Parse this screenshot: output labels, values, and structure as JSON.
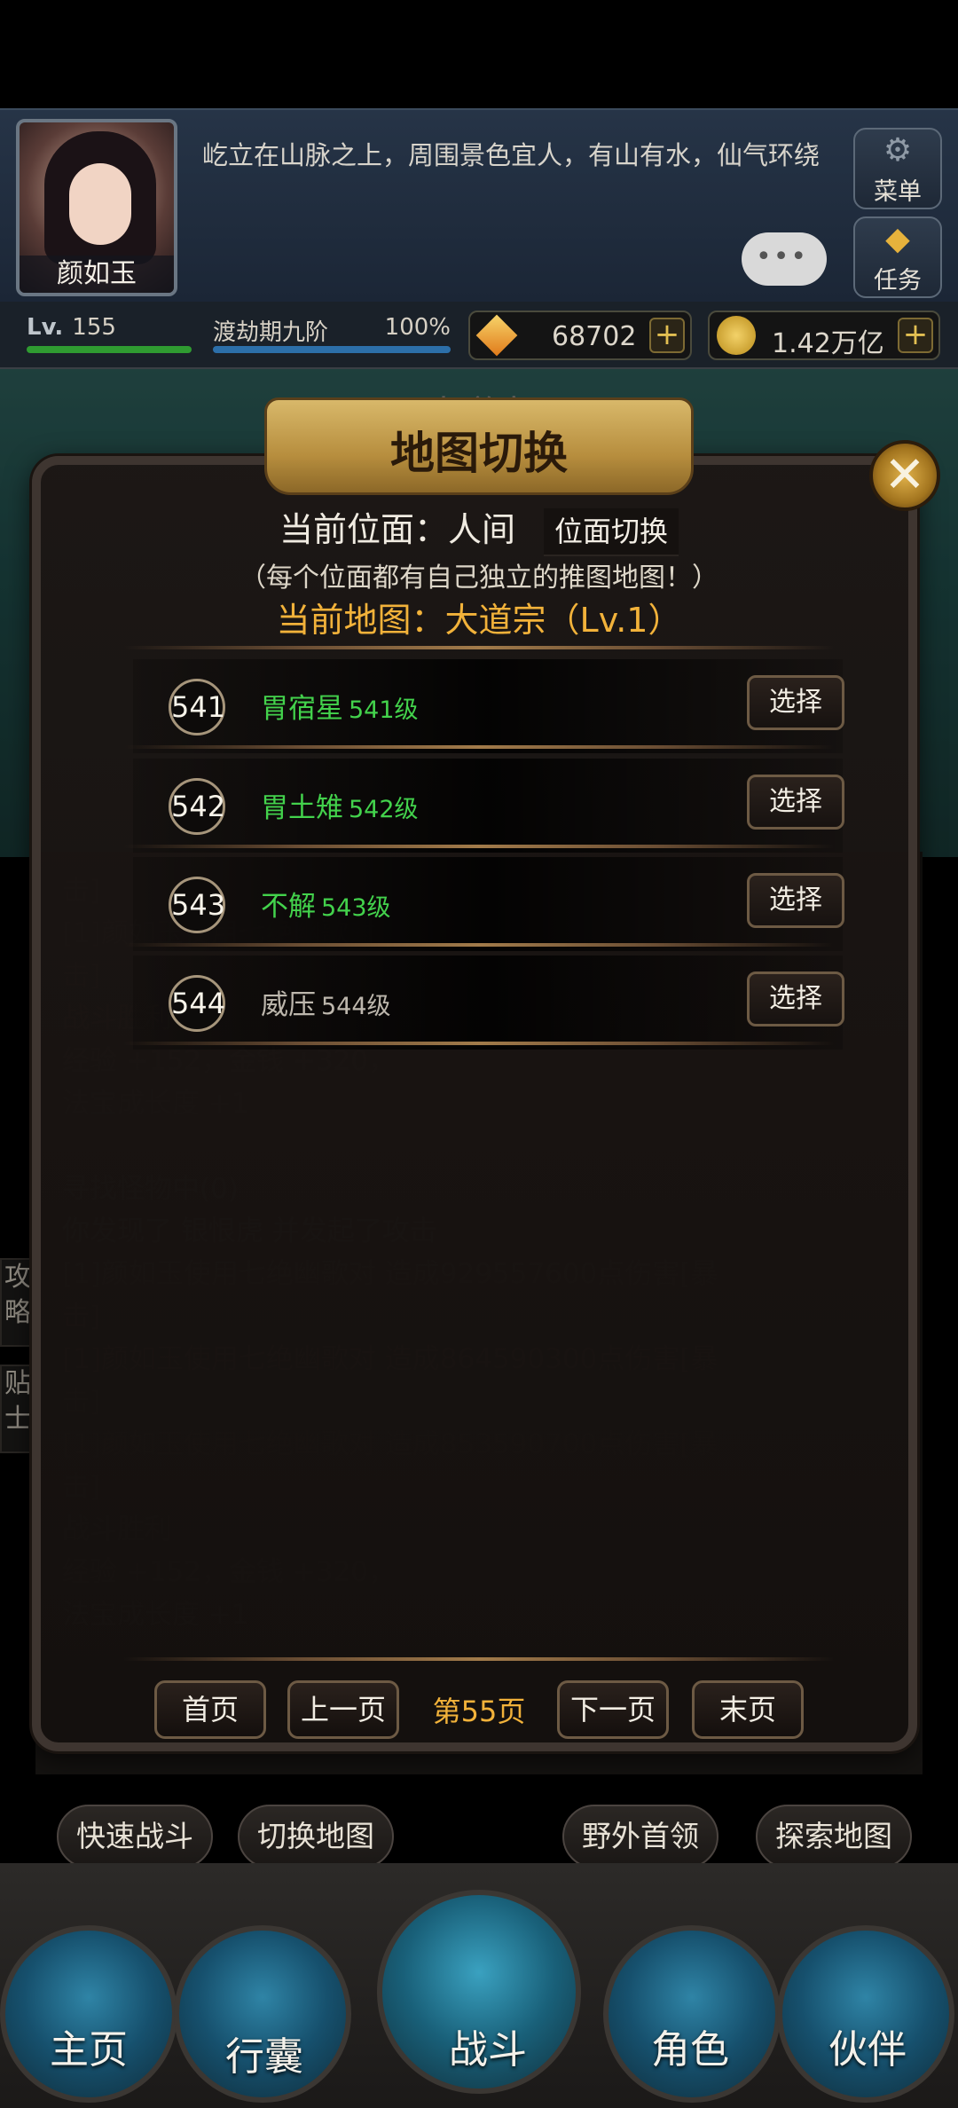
{
  "player": {
    "name": "颜如玉",
    "level_label": "Lv.",
    "level": "155",
    "realm": "渡劫期九阶",
    "realm_progress": "100%",
    "gems": "68702",
    "gold": "1.42万亿"
  },
  "location_description": "屹立在山脉之上，周围景色宜人，有山有水，仙气环绕",
  "menu_label": "菜单",
  "task_label": "任务",
  "scene_title": "大道宗",
  "modal": {
    "title": "地图切换",
    "current_plane_label": "当前位面：人间",
    "plane_switch_label": "位面切换",
    "plane_note": "（每个位面都有自己独立的推图地图！）",
    "current_map": "当前地图：大道宗（Lv.1）",
    "maps": [
      {
        "num": "541",
        "name": "胃宿星",
        "level": "541级",
        "select_label": "选择"
      },
      {
        "num": "542",
        "name": "胃土雉",
        "level": "542级",
        "select_label": "选择"
      },
      {
        "num": "543",
        "name": "不解",
        "level": "543级",
        "select_label": "选择"
      },
      {
        "num": "544",
        "name": "威压",
        "level": "544级",
        "select_label": "选择"
      }
    ],
    "pager": {
      "first": "首页",
      "prev": "上一页",
      "current": "第55页",
      "next": "下一页",
      "last": "末页"
    }
  },
  "log_lines": [
    "击]",
    "[1]颜如玉使用七绝幽歌对",
    "击]",
    "战斗胜利",
    "经验 +152，金钱 +320，",
    "法宝成长度 +1",
    "",
    "寻找怪物中(0)",
    "你发现了 银恨虎 并发起了攻击",
    "[1]颜如玉使用七绝幽歌对                    造成929557600点伤害[暴",
    "击]",
    "[1]颜如玉使用七绝幽歌对                    造成864590300点伤害[暴",
    "击]",
    "[1]颜如玉使用七绝幽歌对                    造成853590700点伤害[暴",
    "击]",
    "战斗胜利",
    "经验 +152，金钱 +320，",
    "法宝成长度 +1"
  ],
  "side_tabs": {
    "strategy": "攻略",
    "tips": "贴士"
  },
  "actions": {
    "quick_battle": "快速战斗",
    "switch_map": "切换地图",
    "wild_boss": "野外首领",
    "explore_map": "探索地图"
  },
  "nav": {
    "home": "主页",
    "bag": "行囊",
    "battle": "战斗",
    "character": "角色",
    "partner": "伙伴"
  }
}
